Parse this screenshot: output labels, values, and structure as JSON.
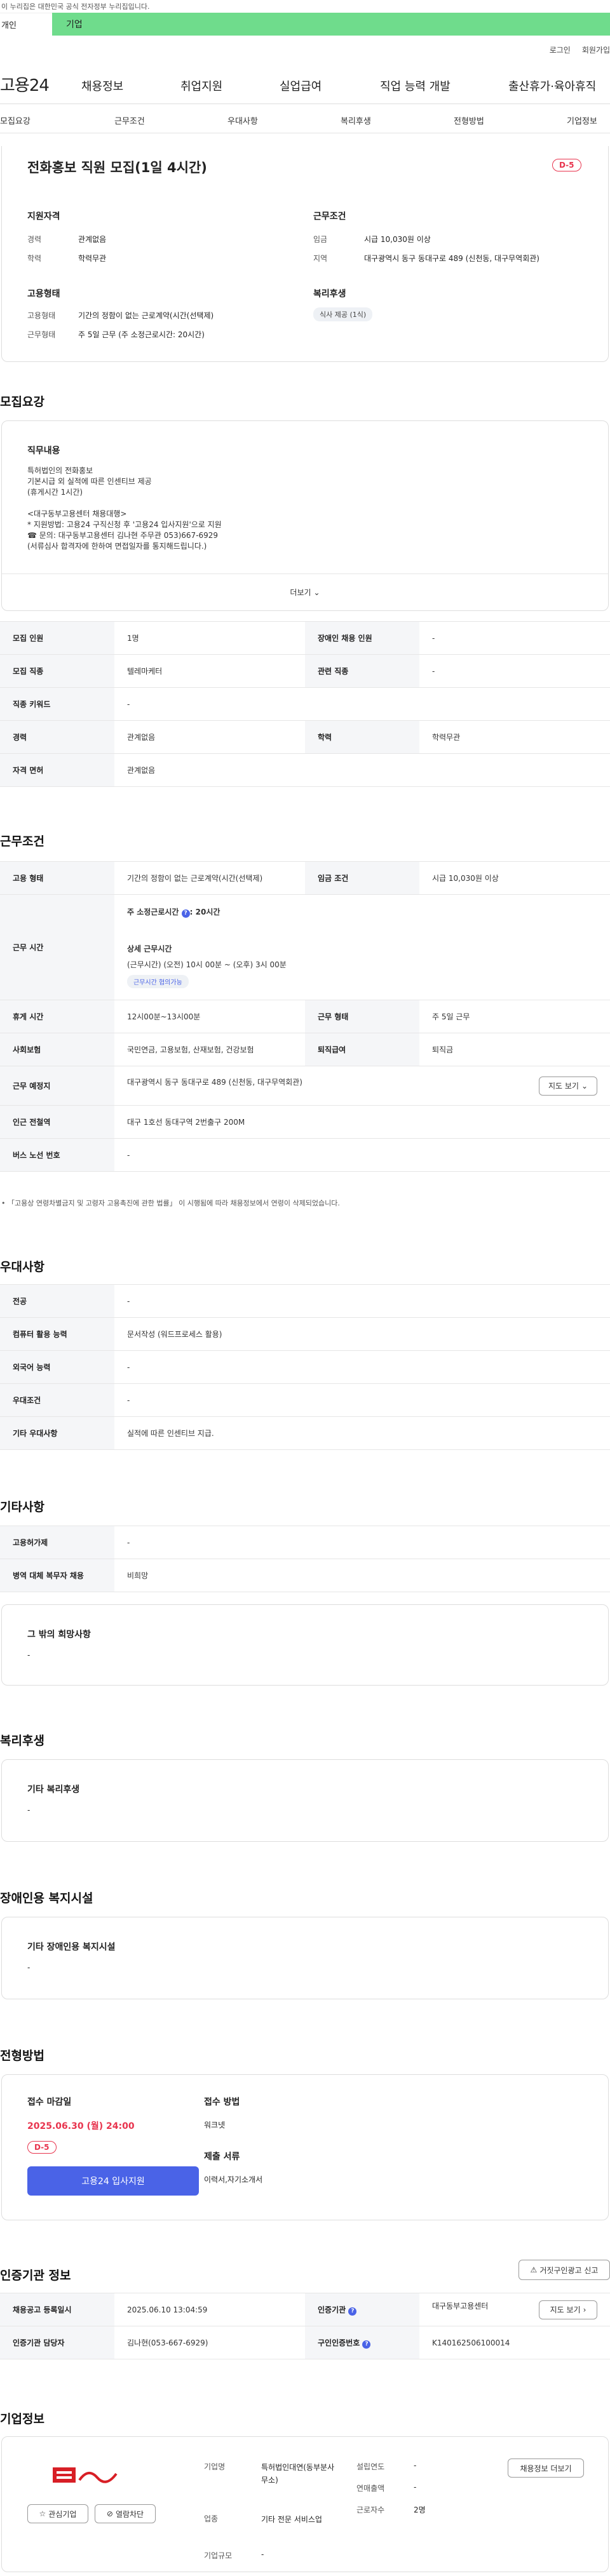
{
  "top": {
    "notice": "이 누리집은 대한민국 공식 전자정부 누리집입니다.",
    "tab_person": "개인",
    "tab_company": "기업"
  },
  "util": {
    "login": "로그인",
    "join": "회원가입"
  },
  "gnb": {
    "logo": "고용24",
    "items": [
      "채용정보",
      "취업지원",
      "실업급여",
      "직업 능력 개발",
      "출산휴가·육아휴직"
    ]
  },
  "subnav": [
    "모집요강",
    "근무조건",
    "우대사항",
    "복리후생",
    "전형방법",
    "기업정보"
  ],
  "summary": {
    "title": "전화홍보 직원 모집(1일 4시간)",
    "dday": "D-5",
    "qual_title": "지원자격",
    "career_label": "경력",
    "career_value": "관계없음",
    "edu_label": "학력",
    "edu_value": "학력무관",
    "cond_title": "근무조건",
    "wage_label": "임금",
    "wage_value": "시급 10,030원 이상",
    "loc_label": "지역",
    "loc_value": "대구광역시 동구 동대구로 489 (신천동, 대구무역회관)",
    "emp_title": "고용형태",
    "emptype_label": "고용형태",
    "emptype_value": "기간의 정함이 없는 근로계약(시간(선택제)",
    "worktime_label": "근무형태",
    "worktime_value": "주 5일 근무 (주 소정근로시간: 20시간)",
    "welfare_title": "복리후생",
    "welfare_tag": "식사 제공 (1식)"
  },
  "recruit": {
    "section_title": "모집요강",
    "job_title": "직무내용",
    "lines": [
      "특허법인의 전화홍보",
      "기본시급 외 실적에 따른 인센티브 제공",
      "(휴게시간 1시간)",
      "",
      "<대구동부고용센터 채용대행>",
      "* 지원방법: 고용24 구직신청 후 '고용24 입사지원'으로 지원",
      "☎ 문의: 대구동부고용센터 김나현 주무관 053)667-6929",
      "(서류심사 합격자에 한하여 면접일자를 통지해드립니다.)"
    ],
    "more": "더보기",
    "rows": [
      [
        "모집 인원",
        "1명",
        "장애인 채용 인원",
        "-"
      ],
      [
        "모집 직종",
        "텔레마케터",
        "관련 직종",
        "-"
      ],
      [
        "직종 키워드",
        "-"
      ],
      [
        "경력",
        "관계없음",
        "학력",
        "학력무관"
      ],
      [
        "자격 면허",
        "관계없음"
      ]
    ]
  },
  "conditions": {
    "section_title": "근무조건",
    "emp_label": "고용 형태",
    "emp_value": "기간의 정함이 없는 근로계약(시간(선택제)",
    "wage_label": "임금 조건",
    "wage_value": "시급 10,030원 이상",
    "time_label": "근무 시간",
    "weekly_hours_label": "주 소정근로시간",
    "weekly_hours_value": "20시간",
    "detail_title": "상세 근무시간",
    "detail_value": "(근무시간) (오전) 10시 00분 ~ (오후) 3시 00분",
    "flex_tag": "근무시간 협의가능",
    "rest_label": "휴게 시간",
    "rest_value": "12시00분~13시00분",
    "form_label": "근무 형태",
    "form_value": "주 5일 근무",
    "ins_label": "사회보험",
    "ins_value": "국민연금, 고용보험, 산재보험, 건강보험",
    "sev_label": "퇴직급여",
    "sev_value": "퇴직금",
    "place_label": "근무 예정지",
    "place_value": "대구광역시 동구 동대구로 489 (신천동, 대구무역회관)",
    "map_btn": "지도 보기",
    "station_label": "인근 전철역",
    "station_value": "대구 1호선 동대구역 2번출구 200M",
    "bus_label": "버스 노선 번호",
    "bus_value": "-",
    "note": "「고용상 연령차별금지 및 고령자 고용촉진에 관한 법률」 이 시행됨에 따라 채용정보에서 연령이 삭제되었습니다."
  },
  "pref": {
    "section_title": "우대사항",
    "rows": [
      [
        "전공",
        "-"
      ],
      [
        "컴퓨터 활용 능력",
        "문서작성 (워드프로세스 활용)"
      ],
      [
        "외국어 능력",
        "-"
      ],
      [
        "우대조건",
        "-"
      ],
      [
        "기타 우대사항",
        "실적에 따른 인센티브 지급."
      ]
    ]
  },
  "etc": {
    "section_title": "기타사항",
    "rows": [
      [
        "고용허가제",
        "-"
      ],
      [
        "병역 대체 복무자 채용",
        "비희망"
      ]
    ],
    "other_title": "그 밖의 희망사항",
    "other_value": "-"
  },
  "welfare": {
    "section_title": "복리후생",
    "title": "기타 복리후생",
    "value": "-"
  },
  "disab": {
    "section_title": "장애인용 복지시설",
    "title": "기타 장애인용 복지시설",
    "value": "-"
  },
  "selection": {
    "section_title": "전형방법",
    "deadline_label": "접수 마감일",
    "deadline_value": "2025.06.30 (월) 24:00",
    "dday": "D-5",
    "apply_btn": "고용24 입사지원",
    "method_label": "접수 방법",
    "method_value": "워크넷",
    "docs_label": "제출 서류",
    "docs_value": "이력서,자기소개서"
  },
  "agency": {
    "section_title": "인증기관 정보",
    "report_btn": "거짓구인광고 신고",
    "reg_date_label": "채용공고 등록일시",
    "reg_date_value": "2025.06.10 13:04:59",
    "agency_label": "인증기관",
    "agency_value": "대구동부고용센터",
    "agency_btn": "지도 보기",
    "staff_label": "인증기관 담당자",
    "staff_value": "김나현(053-667-6929)",
    "no_label": "구인인증번호",
    "no_value": "K140162506100014"
  },
  "company": {
    "section_title": "기업정보",
    "fav_btn": "관심기업",
    "block_btn": "열람차단",
    "name_label": "기업명",
    "name_value": "특허법인대연(동부분사무소)",
    "year_label": "설립연도",
    "year_value": "-",
    "sales_label": "연매출액",
    "sales_value": "-",
    "ind_label": "업종",
    "ind_value": "기타 전문 서비스업",
    "emp_label": "근로자수",
    "emp_value": "2명",
    "size_label": "기업규모",
    "size_value": "-",
    "jobs_btn": "채용정보 더보기"
  },
  "colors": {
    "green": "#6fdc8c",
    "accent": "#4a63e7",
    "dday": "#e8344e"
  }
}
